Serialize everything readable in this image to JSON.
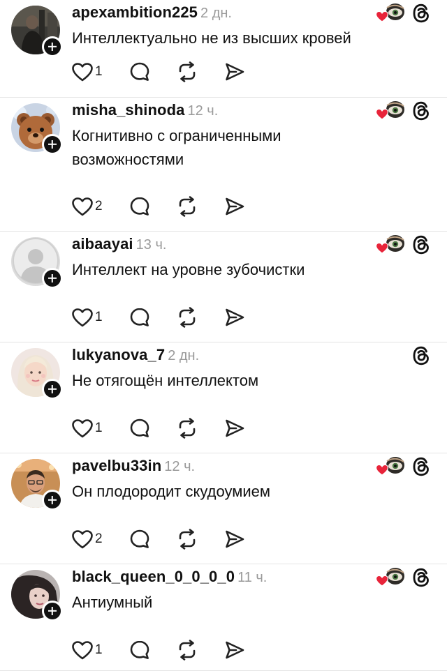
{
  "colors": {
    "text": "#111111",
    "muted": "#9a9a9a",
    "separator": "#e4e4e4",
    "like_red": "#e8243a",
    "icon_stroke": "#222222"
  },
  "icons": {
    "like": "heart-outline-icon",
    "comment": "speech-bubble-icon",
    "repost": "repost-arrows-icon",
    "share": "send-paper-plane-icon",
    "threads": "threads-logo-icon",
    "reaction": "creator-liked-heart-eye-icon"
  },
  "posts": [
    {
      "username": "apexambition225",
      "time": "2 дн.",
      "text": "Интеллектуально не из высших кровей",
      "likes": "1",
      "creator_liked": true,
      "avatar": "photo-dark-figure"
    },
    {
      "username": "misha_shinoda",
      "time": "12 ч.",
      "text": "Когнитивно с ограниченными возможностями",
      "likes": "2",
      "creator_liked": true,
      "avatar": "photo-teddy-bear"
    },
    {
      "username": "aibaayai",
      "time": "13 ч.",
      "text": "Интеллект на уровне зубочистки",
      "likes": "1",
      "creator_liked": true,
      "avatar": "default-silhouette"
    },
    {
      "username": "lukyanova_7",
      "time": "2 дн.",
      "text": "Не отягощён интеллектом",
      "likes": "1",
      "creator_liked": false,
      "avatar": "photo-blonde-woman"
    },
    {
      "username": "pavelbu33in",
      "time": "12 ч.",
      "text": "Он плодородит скудоумием",
      "likes": "2",
      "creator_liked": true,
      "avatar": "photo-man-glasses"
    },
    {
      "username": "black_queen_0_0_0_0",
      "time": "11 ч.",
      "text": "Антиумный",
      "likes": "1",
      "creator_liked": true,
      "avatar": "photo-dark-hair-woman"
    }
  ]
}
